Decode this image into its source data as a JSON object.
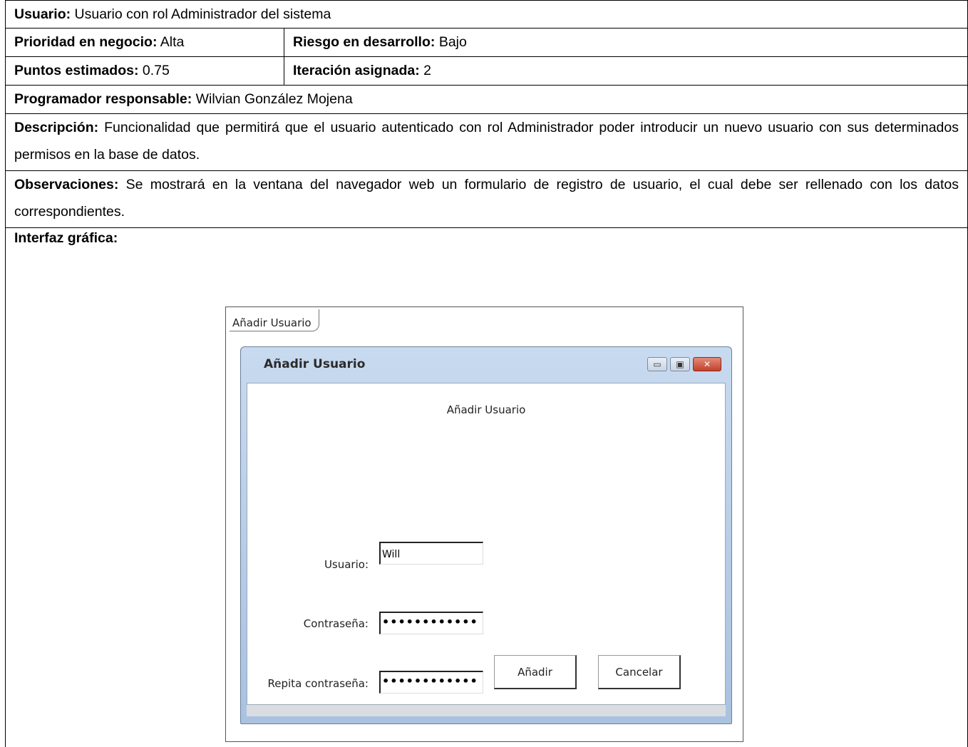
{
  "rows": {
    "usuario": {
      "label": "Usuario:",
      "value": "Usuario con rol Administrador del sistema"
    },
    "prioridad": {
      "label": "Prioridad en negocio:",
      "value": "Alta"
    },
    "riesgo": {
      "label": "Riesgo en desarrollo:",
      "value": "Bajo"
    },
    "puntos": {
      "label": "Puntos estimados:",
      "value": "0.75"
    },
    "iteracion": {
      "label": "Iteración asignada:",
      "value": "2"
    },
    "programador": {
      "label": "Programador responsable:",
      "value": "Wilvian González Mojena"
    },
    "descripcion": {
      "label": "Descripción:",
      "value": "Funcionalidad que permitirá que el usuario autenticado con rol Administrador poder introducir un nuevo usuario con sus determinados permisos en la base de datos."
    },
    "observaciones": {
      "label": "Observaciones:",
      "value": "Se mostrará en la ventana del navegador web un formulario de registro de usuario, el cual debe ser rellenado con los datos correspondientes."
    },
    "interfaz": {
      "label": "Interfaz gráfica:"
    }
  },
  "mockup": {
    "tab_label": "Añadir Usuario",
    "window_title": "Añadir Usuario",
    "controls": {
      "minimize": "▭",
      "maximize": "▣",
      "close": "✕"
    },
    "heading": "Añadir Usuario",
    "fields": {
      "usuario": {
        "label": "Usuario:",
        "value": "Will"
      },
      "contrasena": {
        "label": "Contraseña:",
        "value": "••••••••••••"
      },
      "repita": {
        "label": "Repita contraseña:",
        "value": "••••••••••••"
      }
    },
    "buttons": {
      "add": "Añadir",
      "cancel": "Cancelar"
    }
  }
}
